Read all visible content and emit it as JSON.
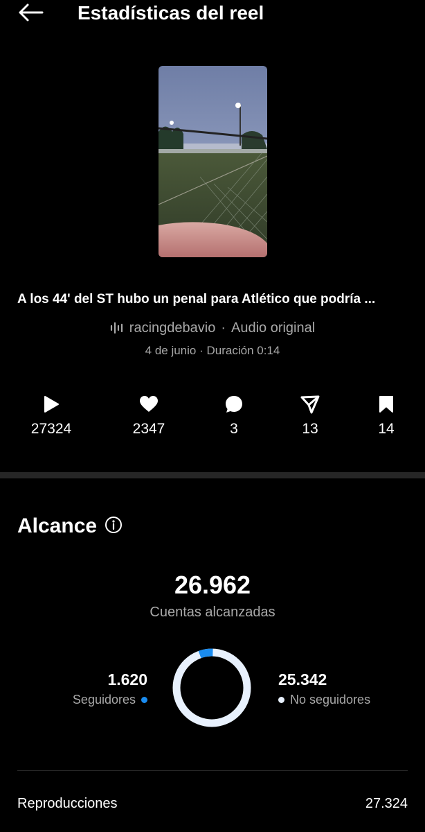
{
  "header": {
    "title": "Estadísticas del reel"
  },
  "reel": {
    "caption": "A los 44' del ST hubo un penal para Atlético que podría ...",
    "account": "racingdebavio",
    "audio_separator": "·",
    "audio": "Audio original",
    "date": "4 de junio",
    "meta_separator": "·",
    "duration": "Duración 0:14"
  },
  "stats": {
    "plays": "27324",
    "likes": "2347",
    "comments": "3",
    "shares": "13",
    "saves": "14"
  },
  "reach": {
    "title": "Alcance",
    "accounts_reached": "26.962",
    "accounts_reached_label": "Cuentas alcanzadas",
    "followers_value": "1.620",
    "followers_label": "Seguidores",
    "followers_fraction": 0.06,
    "non_followers_value": "25.342",
    "non_followers_label": "No seguidores",
    "non_followers_fraction": 0.94,
    "followers_color": "#1a8cf0",
    "non_followers_color": "#e8f1fd"
  },
  "details": {
    "plays_label": "Reproducciones",
    "plays_value": "27.324"
  }
}
